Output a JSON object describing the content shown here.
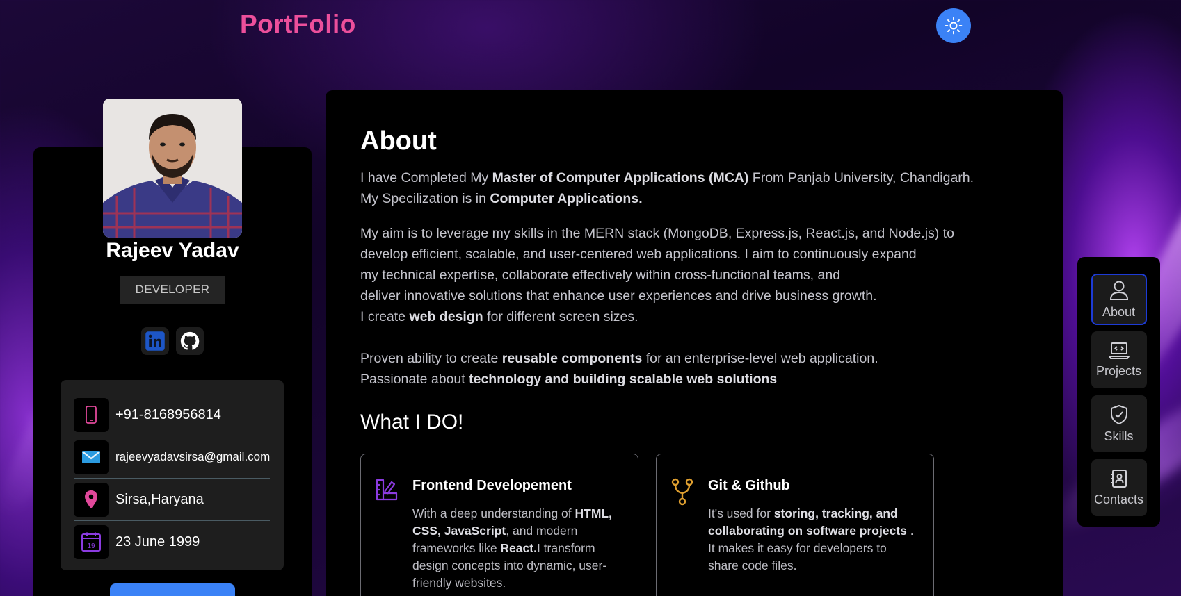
{
  "header": {
    "brand": "PortFolio",
    "theme_toggle_icon": "sun-icon"
  },
  "profile": {
    "name": "Rajeev Yadav",
    "role": "DEVELOPER",
    "socials": [
      {
        "name": "linkedin",
        "icon": "linkedin-icon"
      },
      {
        "name": "github",
        "icon": "github-icon"
      }
    ],
    "contacts": {
      "phone": "+91-8168956814",
      "email": "rajeevyadavsirsa@gmail.com",
      "location": "Sirsa,Haryana",
      "birthday": "23 June 1999",
      "calendar_day": "19"
    }
  },
  "about": {
    "title": "About",
    "p1": {
      "t1": "I have Completed My ",
      "b1": "Master of Computer Applications (MCA)",
      "t2": " From Panjab University, Chandigarh.",
      "t3": "My Specilization is in ",
      "b2": "Computer Applications."
    },
    "p2": {
      "l1": "My aim is to leverage my skills in the MERN stack (MongoDB, Express.js, React.js, and Node.js) to",
      "l2": "develop efficient, scalable, and user-centered web applications. I aim to continuously expand",
      "l3": "my technical expertise, collaborate effectively within cross-functional teams, and",
      "l4": "deliver innovative solutions that enhance user experiences and drive business growth.",
      "l5a": "I create ",
      "l5b": "web design",
      "l5c": " for different screen sizes."
    },
    "p3": {
      "t1": "Proven ability to create ",
      "b1": "reusable components",
      "t2": " for an enterprise-level web application.",
      "t3": "Passionate about ",
      "b2": "technology and building scalable web solutions"
    }
  },
  "what_i_do": {
    "title": "What I DO!",
    "services": [
      {
        "title": "Frontend Developement",
        "t1": "With a deep understanding of ",
        "b1": "HTML, CSS, JavaScript",
        "t2": ", and modern frameworks like ",
        "b2": "React.",
        "t3": "I transform design concepts into dynamic, user-friendly websites."
      },
      {
        "title": "Git & Github",
        "t1": "It's used for ",
        "b1": "storing, tracking, and collaborating on software projects",
        "t2": " . It makes it easy for developers to share code files."
      }
    ]
  },
  "nav": {
    "items": [
      {
        "label": "About",
        "icon": "user-icon"
      },
      {
        "label": "Projects",
        "icon": "laptop-code-icon"
      },
      {
        "label": "Skills",
        "icon": "shield-check-icon"
      },
      {
        "label": "Contacts",
        "icon": "contact-book-icon"
      }
    ],
    "active": "About"
  },
  "colors": {
    "brand": "#ec4f9b",
    "accent": "#3b82f6",
    "panel": "#000000"
  }
}
